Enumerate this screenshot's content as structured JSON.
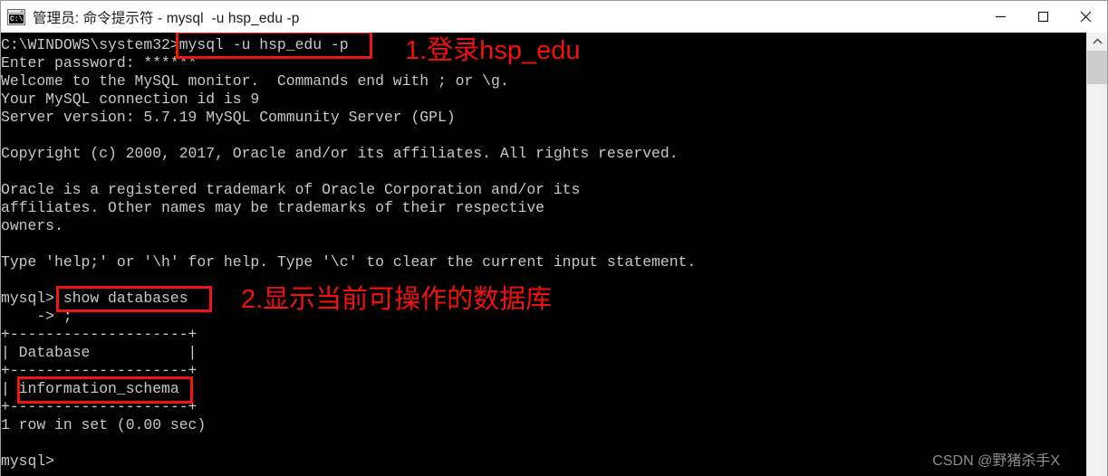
{
  "window": {
    "title": "管理员: 命令提示符 - mysql  -u hsp_edu -p",
    "icon_name": "cmd-console-icon",
    "icon_glyph": "C:\\",
    "controls": {
      "minimize_label": "minimize-icon",
      "maximize_label": "maximize-icon",
      "close_label": "close-icon"
    }
  },
  "console": {
    "background_color": "#000000",
    "text_color": "#c8c8c8",
    "lines": [
      "C:\\WINDOWS\\system32>mysql -u hsp_edu -p",
      "Enter password: ******",
      "Welcome to the MySQL monitor.  Commands end with ; or \\g.",
      "Your MySQL connection id is 9",
      "Server version: 5.7.19 MySQL Community Server (GPL)",
      "",
      "Copyright (c) 2000, 2017, Oracle and/or its affiliates. All rights reserved.",
      "",
      "Oracle is a registered trademark of Oracle Corporation and/or its",
      "affiliates. Other names may be trademarks of their respective",
      "owners.",
      "",
      "Type 'help;' or '\\h' for help. Type '\\c' to clear the current input statement.",
      "",
      "mysql> show databases",
      "    -> ;",
      "+--------------------+",
      "| Database           |",
      "+--------------------+",
      "| information_schema |",
      "+--------------------+",
      "1 row in set (0.00 sec)",
      "",
      "mysql>"
    ],
    "command_1": "mysql -u hsp_edu -p",
    "password_mask": "******",
    "prompt": "mysql>",
    "continuation_prompt": "    -> ;",
    "query": "show databases",
    "result_table": {
      "columns": [
        "Database"
      ],
      "rows": [
        [
          "information_schema"
        ]
      ],
      "row_count_text": "1 row in set (0.00 sec)"
    }
  },
  "annotations": {
    "color": "#f50f0f",
    "items": [
      {
        "name": "annotation-login",
        "text": "1.登录hsp_edu"
      },
      {
        "name": "annotation-show-databases",
        "text": "2.显示当前可操作的数据库"
      }
    ],
    "highlight_boxes": [
      {
        "name": "highlight-mysql-login-command"
      },
      {
        "name": "highlight-show-databases-command"
      },
      {
        "name": "highlight-information-schema-row"
      }
    ]
  },
  "watermark": {
    "text": "CSDN @野猪杀手X",
    "color": "#8e8e8e"
  },
  "scrollbar": {
    "up_arrow": "chevron-up-icon"
  }
}
